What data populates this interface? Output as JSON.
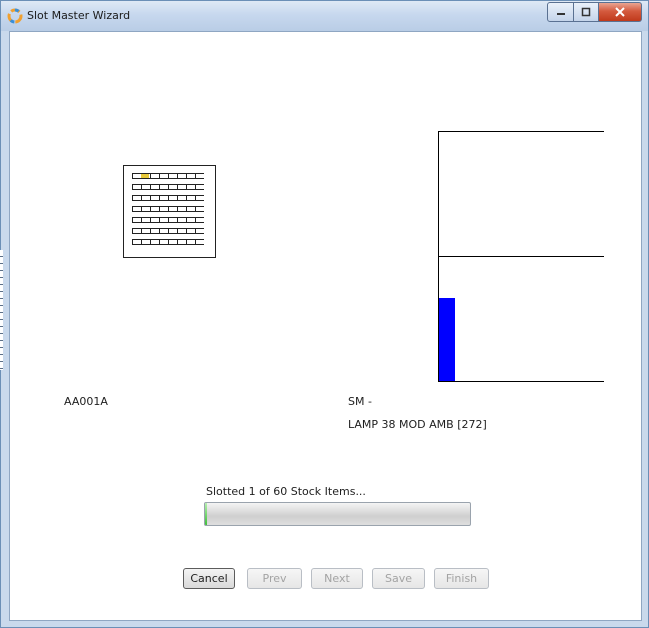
{
  "window": {
    "title": "Slot Master Wizard",
    "icon": "app-icon",
    "caption_buttons": [
      "minimize-icon",
      "maximize-icon",
      "close-icon"
    ]
  },
  "drawing": {
    "location_code": "AA001A",
    "sm_label": "SM -",
    "item_label": "LAMP 38 MOD AMB [272]",
    "active_slot_color": "#e8c93a",
    "bay_fill_color": "#0000ff"
  },
  "progress": {
    "status_text": "Slotted 1 of 60 Stock Items...",
    "value": 1,
    "max": 60
  },
  "buttons": {
    "cancel": "Cancel",
    "prev": "Prev",
    "next": "Next",
    "save": "Save",
    "finish": "Finish"
  }
}
